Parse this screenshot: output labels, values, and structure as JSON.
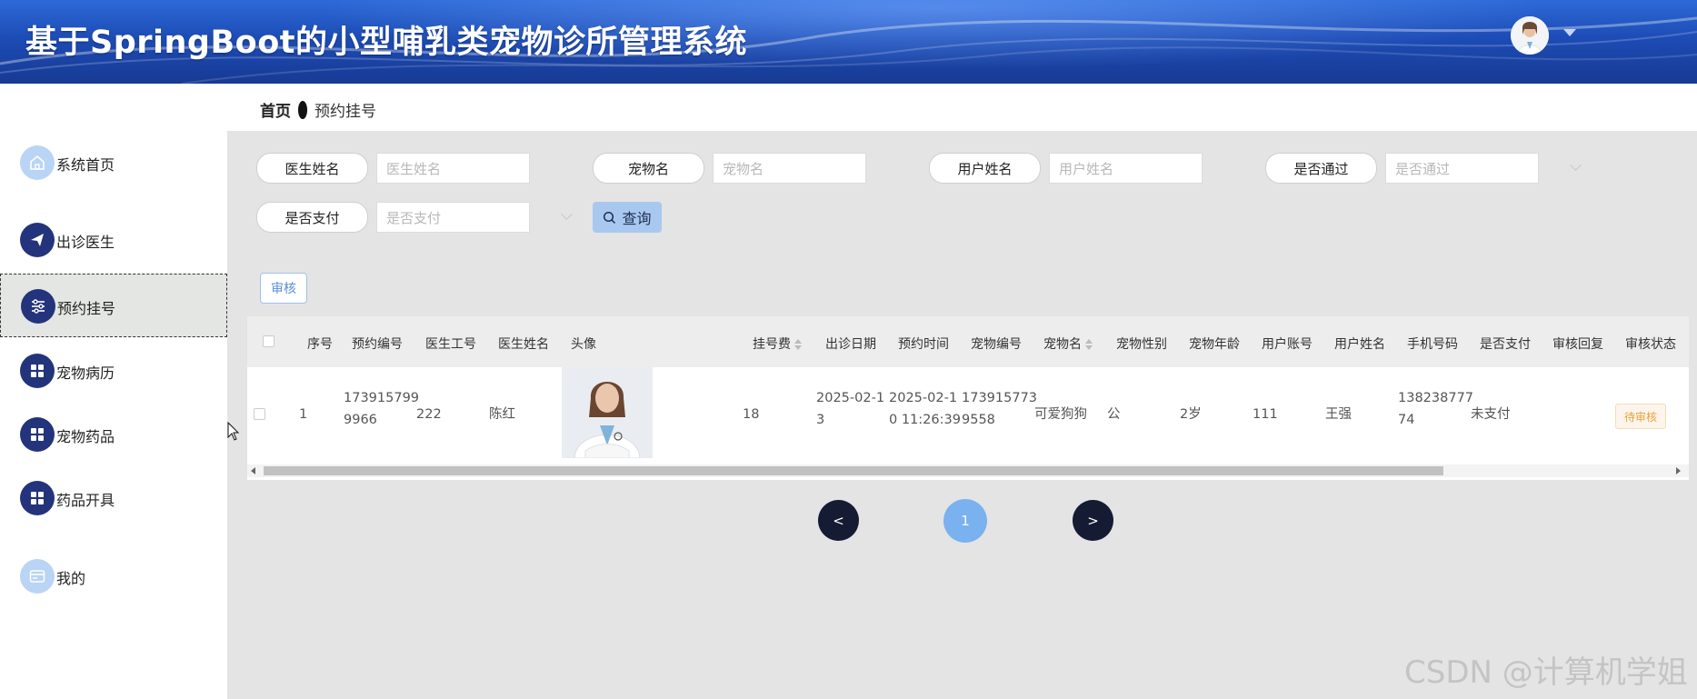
{
  "header": {
    "title": "基于SpringBoot的小型哺乳类宠物诊所管理系统"
  },
  "breadcrumb": {
    "home": "首页",
    "current": "预约挂号"
  },
  "sidebar": {
    "items": [
      {
        "label": "系统首页",
        "icon": "home-icon"
      },
      {
        "label": "出诊医生",
        "icon": "send-icon"
      },
      {
        "label": "预约挂号",
        "icon": "sliders-icon",
        "active": true
      },
      {
        "label": "宠物病历",
        "icon": "grid-icon"
      },
      {
        "label": "宠物药品",
        "icon": "grid-icon"
      },
      {
        "label": "药品开具",
        "icon": "grid-icon"
      },
      {
        "label": "我的",
        "icon": "card-icon"
      }
    ]
  },
  "search": {
    "fields": [
      {
        "label": "医生姓名",
        "placeholder": "医生姓名"
      },
      {
        "label": "宠物名",
        "placeholder": "宠物名"
      },
      {
        "label": "用户姓名",
        "placeholder": "用户姓名"
      },
      {
        "label": "是否通过",
        "placeholder": "是否通过"
      },
      {
        "label": "是否支付",
        "placeholder": "是否支付"
      }
    ],
    "query_label": "查询"
  },
  "actions": {
    "review_label": "审核"
  },
  "table": {
    "columns": [
      "序号",
      "预约编号",
      "医生工号",
      "医生姓名",
      "头像",
      "挂号费",
      "出诊日期",
      "预约时间",
      "宠物编号",
      "宠物名",
      "宠物性别",
      "宠物年龄",
      "用户账号",
      "用户姓名",
      "手机号码",
      "是否支付",
      "审核回复",
      "审核状态"
    ],
    "rows": [
      {
        "index": "1",
        "booking_no": "1739157999966",
        "booking_no_l1": "173915799",
        "booking_no_l2": "9966",
        "doctor_id": "222",
        "doctor_name": "陈红",
        "fee": "18",
        "visit_date_l1": "2025-02-1",
        "visit_date_l2": "3",
        "booking_time_l1": "2025-02-1",
        "booking_time_l2": "0 11:26:39",
        "pet_no_l1": "173915773",
        "pet_no_l2": "9558",
        "pet_name": "可爱狗狗",
        "pet_gender": "公",
        "pet_age": "2岁",
        "user_account": "111",
        "user_name": "王强",
        "phone_l1": "138238777",
        "phone_l2": "74",
        "paid": "未支付",
        "review_reply": "",
        "review_status": "待审核"
      }
    ]
  },
  "pagination": {
    "prev": "<",
    "current": "1",
    "next": ">"
  },
  "watermark": "CSDN @计算机学姐"
}
